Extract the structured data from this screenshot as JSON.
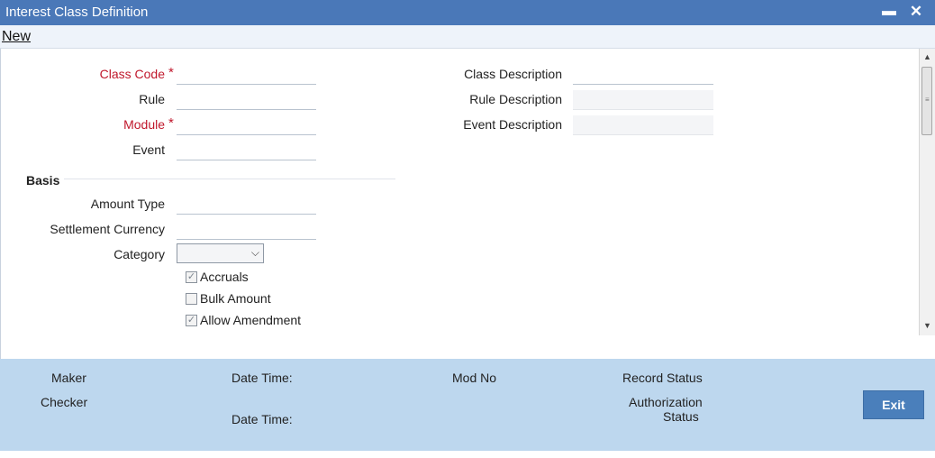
{
  "window": {
    "title": "Interest Class Definition",
    "minimize_glyph": "▬",
    "close_glyph": "✕"
  },
  "menu": {
    "new_label": "New"
  },
  "form": {
    "class_code": {
      "label": "Class Code",
      "value": ""
    },
    "rule": {
      "label": "Rule",
      "value": ""
    },
    "module": {
      "label": "Module",
      "value": ""
    },
    "event": {
      "label": "Event",
      "value": ""
    },
    "class_description": {
      "label": "Class Description",
      "value": ""
    },
    "rule_description": {
      "label": "Rule Description",
      "value": ""
    },
    "event_description": {
      "label": "Event Description",
      "value": ""
    },
    "required_marker": "*"
  },
  "basis": {
    "title": "Basis",
    "amount_type": {
      "label": "Amount Type",
      "value": ""
    },
    "settlement_currency": {
      "label": "Settlement Currency",
      "value": ""
    },
    "category": {
      "label": "Category",
      "selected": ""
    },
    "accruals": {
      "label": "Accruals",
      "checked": true
    },
    "bulk_amount": {
      "label": "Bulk Amount",
      "checked": false
    },
    "allow_amendment": {
      "label": "Allow Amendment",
      "checked": true
    }
  },
  "footer": {
    "maker": "Maker",
    "checker": "Checker",
    "date_time_1": "Date Time:",
    "date_time_2": "Date Time:",
    "mod_no": "Mod No",
    "record_status": "Record Status",
    "authorization": "Authorization",
    "status": "Status",
    "exit_label": "Exit"
  },
  "colors": {
    "titlebar": "#4a78b8",
    "required": "#c0182c",
    "footer": "#bdd7ee",
    "exit_button": "#4a7fbb"
  }
}
